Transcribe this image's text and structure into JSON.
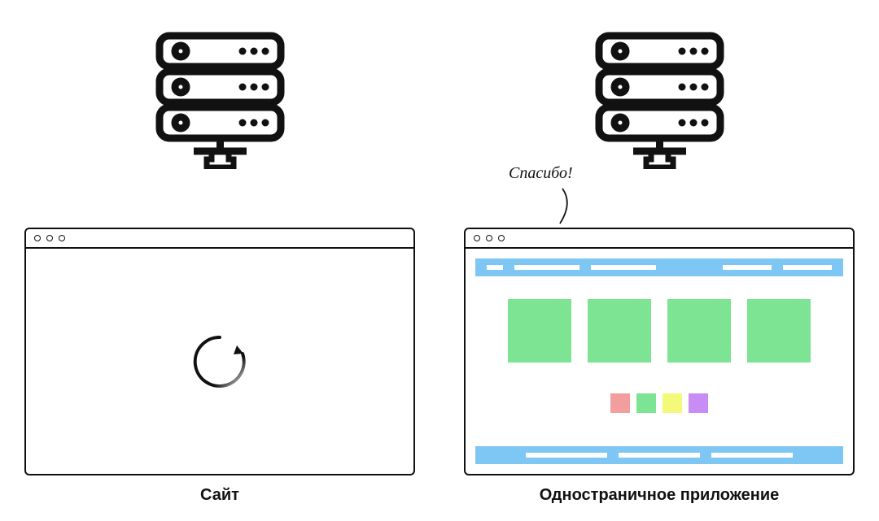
{
  "left": {
    "caption": "Сайт"
  },
  "right": {
    "caption": "Одностраничное приложение",
    "speech": "Спасибо!"
  },
  "colors": {
    "blue": "#7ec7f5",
    "green": "#7ce493",
    "pink": "#f39e9e",
    "yellow": "#f4f97a",
    "purple": "#c88cf5"
  }
}
